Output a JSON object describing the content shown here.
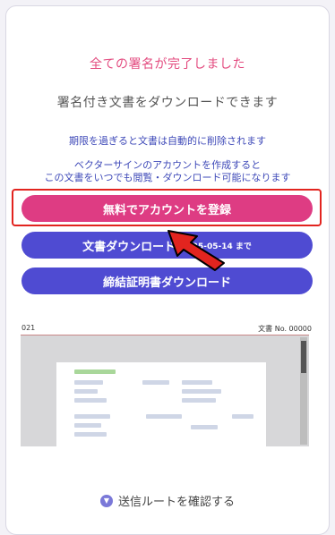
{
  "messages": {
    "title": "全ての署名が完了しました",
    "subtitle": "署名付き文書をダウンロードできます",
    "notice1": "期限を過ぎると文書は自動的に削除されます",
    "notice2_line1": "ベクターサインのアカウントを作成すると",
    "notice2_line2": "この文書をいつでも閲覧・ダウンロード可能になります"
  },
  "buttons": {
    "register": "無料でアカウントを登録",
    "download": "文書ダウンロード",
    "download_deadline": "2025-05-14 まで",
    "certificate": "締結証明書ダウンロード"
  },
  "preview": {
    "left_label": "021",
    "right_label": "文書 No. 00000"
  },
  "footer": {
    "route_link": "送信ルートを確認する"
  },
  "colors": {
    "pink": "#de3c83",
    "blue": "#4f4bd2",
    "title_pink": "#e34b7f",
    "notice_blue": "#3e49b8",
    "highlight_red": "#e2241f"
  },
  "icons": {
    "footer": "chevron-down-circle-icon",
    "annotation": "red-arrow-pointer"
  }
}
